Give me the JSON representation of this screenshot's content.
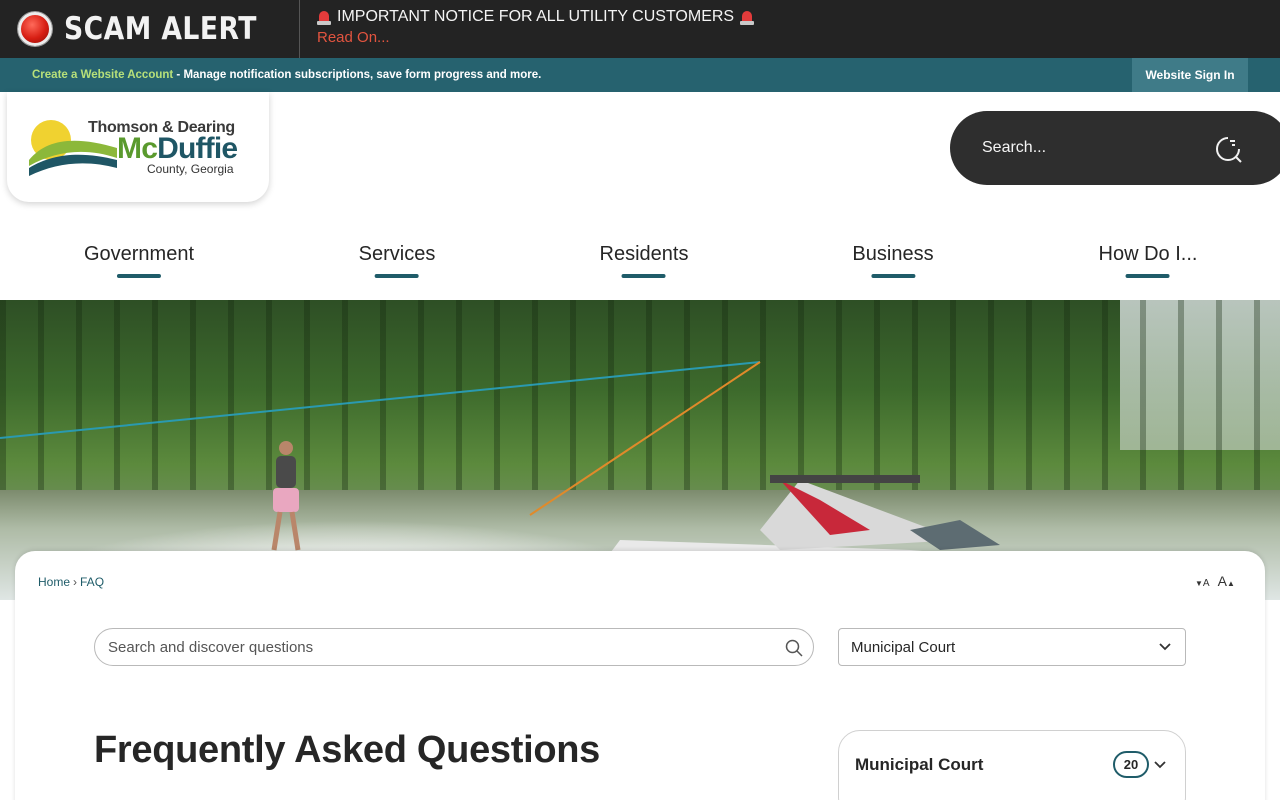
{
  "alert_bar": {
    "title": "SCAM ALERT",
    "notice": "IMPORTANT NOTICE FOR ALL UTILITY CUSTOMERS",
    "read_more": "Read On..."
  },
  "account_bar": {
    "link_text": "Create a Website Account",
    "description": " - Manage notification subscriptions, save form progress and more.",
    "sign_in": "Website Sign In"
  },
  "logo": {
    "line1": "Thomson & Dearing",
    "line2_mc": "Mc",
    "line2_rest": "Duffie",
    "line3": "County, Georgia"
  },
  "site_search": {
    "placeholder": "Search..."
  },
  "nav": [
    {
      "label": "Government"
    },
    {
      "label": "Services"
    },
    {
      "label": "Residents"
    },
    {
      "label": "Business"
    },
    {
      "label": "How Do I..."
    }
  ],
  "breadcrumb": {
    "home": "Home",
    "separator": "›",
    "current": "FAQ"
  },
  "text_size": {
    "decrease": "A",
    "increase": "A"
  },
  "faq_search": {
    "placeholder": "Search and discover questions"
  },
  "category_select": {
    "selected": "Municipal Court"
  },
  "page_title": "Frequently Asked Questions",
  "category_panel": {
    "title": "Municipal Court",
    "count": "20"
  },
  "colors": {
    "brand_teal": "#1f5c69",
    "account_bar": "#26626f",
    "alert_red": "#e2543f",
    "link_green": "#b7e07a"
  }
}
